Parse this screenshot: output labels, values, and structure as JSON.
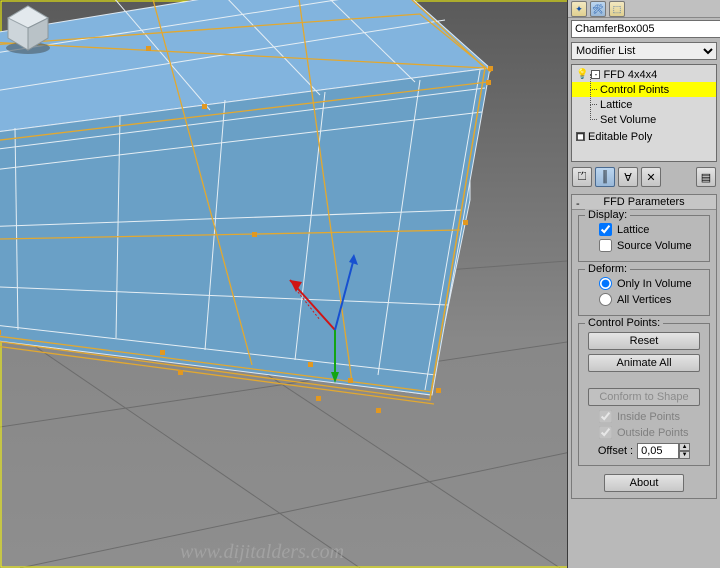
{
  "object": {
    "name": "ChamferBox005",
    "color": "#1f3fb0"
  },
  "modifierList": {
    "placeholder": "Modifier List"
  },
  "stack": {
    "ffd": "FFD 4x4x4",
    "sub": {
      "controlPoints": "Control Points",
      "lattice": "Lattice",
      "setVolume": "Set Volume"
    },
    "editablePoly": "Editable Poly"
  },
  "rollout": {
    "header": "FFD Parameters",
    "display": {
      "title": "Display:",
      "lattice": "Lattice",
      "sourceVolume": "Source Volume"
    },
    "deform": {
      "title": "Deform:",
      "onlyInVolume": "Only In Volume",
      "allVertices": "All Vertices"
    },
    "controlPoints": {
      "title": "Control Points:",
      "reset": "Reset",
      "animateAll": "Animate All",
      "conform": "Conform to Shape",
      "inside": "Inside Points",
      "outside": "Outside Points",
      "offsetLabel": "Offset :",
      "offsetValue": "0,05"
    },
    "about": "About"
  },
  "watermark": "www.dijitalders.com"
}
